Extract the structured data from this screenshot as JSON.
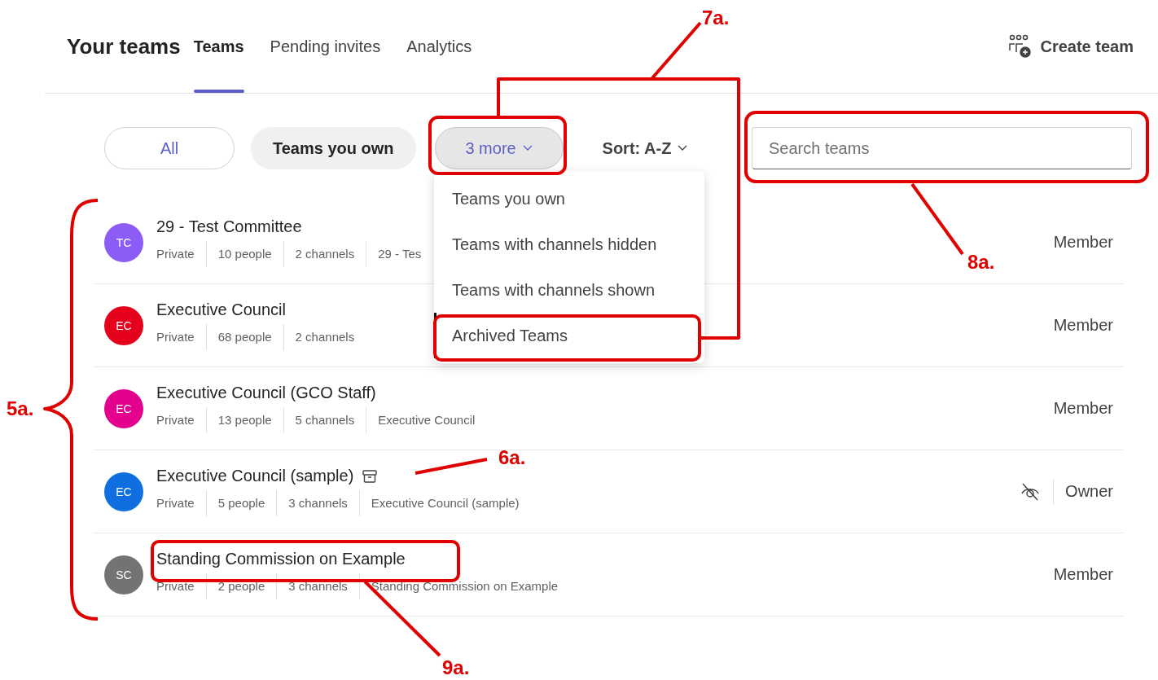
{
  "header": {
    "title": "Your teams",
    "tabs": [
      {
        "label": "Teams",
        "selected": true
      },
      {
        "label": "Pending invites",
        "selected": false
      },
      {
        "label": "Analytics",
        "selected": false
      }
    ],
    "create_button": "Create team"
  },
  "filters": {
    "chips": [
      {
        "label": "All",
        "selected": true
      },
      {
        "label": "Teams you own",
        "selected": false
      }
    ],
    "more": {
      "label": "3 more",
      "expanded": true
    },
    "sort": "Sort: A-Z",
    "search": {
      "placeholder": "Search teams"
    }
  },
  "menu": {
    "items": [
      {
        "label": "Teams you own",
        "selected": false
      },
      {
        "label": "Teams with channels hidden",
        "selected": false
      },
      {
        "label": "Teams with channels shown",
        "selected": false
      },
      {
        "label": "Archived Teams",
        "selected": true
      }
    ]
  },
  "teams": [
    {
      "initials": "TC",
      "color": "#8b5cf6",
      "name": "29 - Test Committee",
      "archived": false,
      "meta": [
        "Private",
        "10 people",
        "2 channels",
        "29 - Tes"
      ],
      "channels_hidden": false,
      "role": "Member"
    },
    {
      "initials": "EC",
      "color": "#e5001c",
      "name": "Executive Council",
      "archived": false,
      "meta": [
        "Private",
        "68 people",
        "2 channels"
      ],
      "channels_hidden": false,
      "role": "Member"
    },
    {
      "initials": "EC",
      "color": "#e3008c",
      "name": "Executive Council (GCO Staff)",
      "archived": false,
      "meta": [
        "Private",
        "13 people",
        "5 channels",
        "Executive Council"
      ],
      "channels_hidden": false,
      "role": "Member"
    },
    {
      "initials": "EC",
      "color": "#0f6fe0",
      "name": "Executive Council (sample)",
      "archived": true,
      "meta": [
        "Private",
        "5 people",
        "3 channels",
        "Executive Council (sample)"
      ],
      "channels_hidden": true,
      "role": "Owner"
    },
    {
      "initials": "SC",
      "color": "#737373",
      "name": "Standing Commission on Example",
      "archived": false,
      "meta": [
        "Private",
        "2 people",
        "3 channels",
        "Standing Commission on Example"
      ],
      "channels_hidden": false,
      "role": "Member"
    }
  ],
  "annotations": [
    {
      "label": "7a."
    },
    {
      "label": "8a."
    },
    {
      "label": "5a."
    },
    {
      "label": "6a."
    },
    {
      "label": "9a."
    }
  ]
}
